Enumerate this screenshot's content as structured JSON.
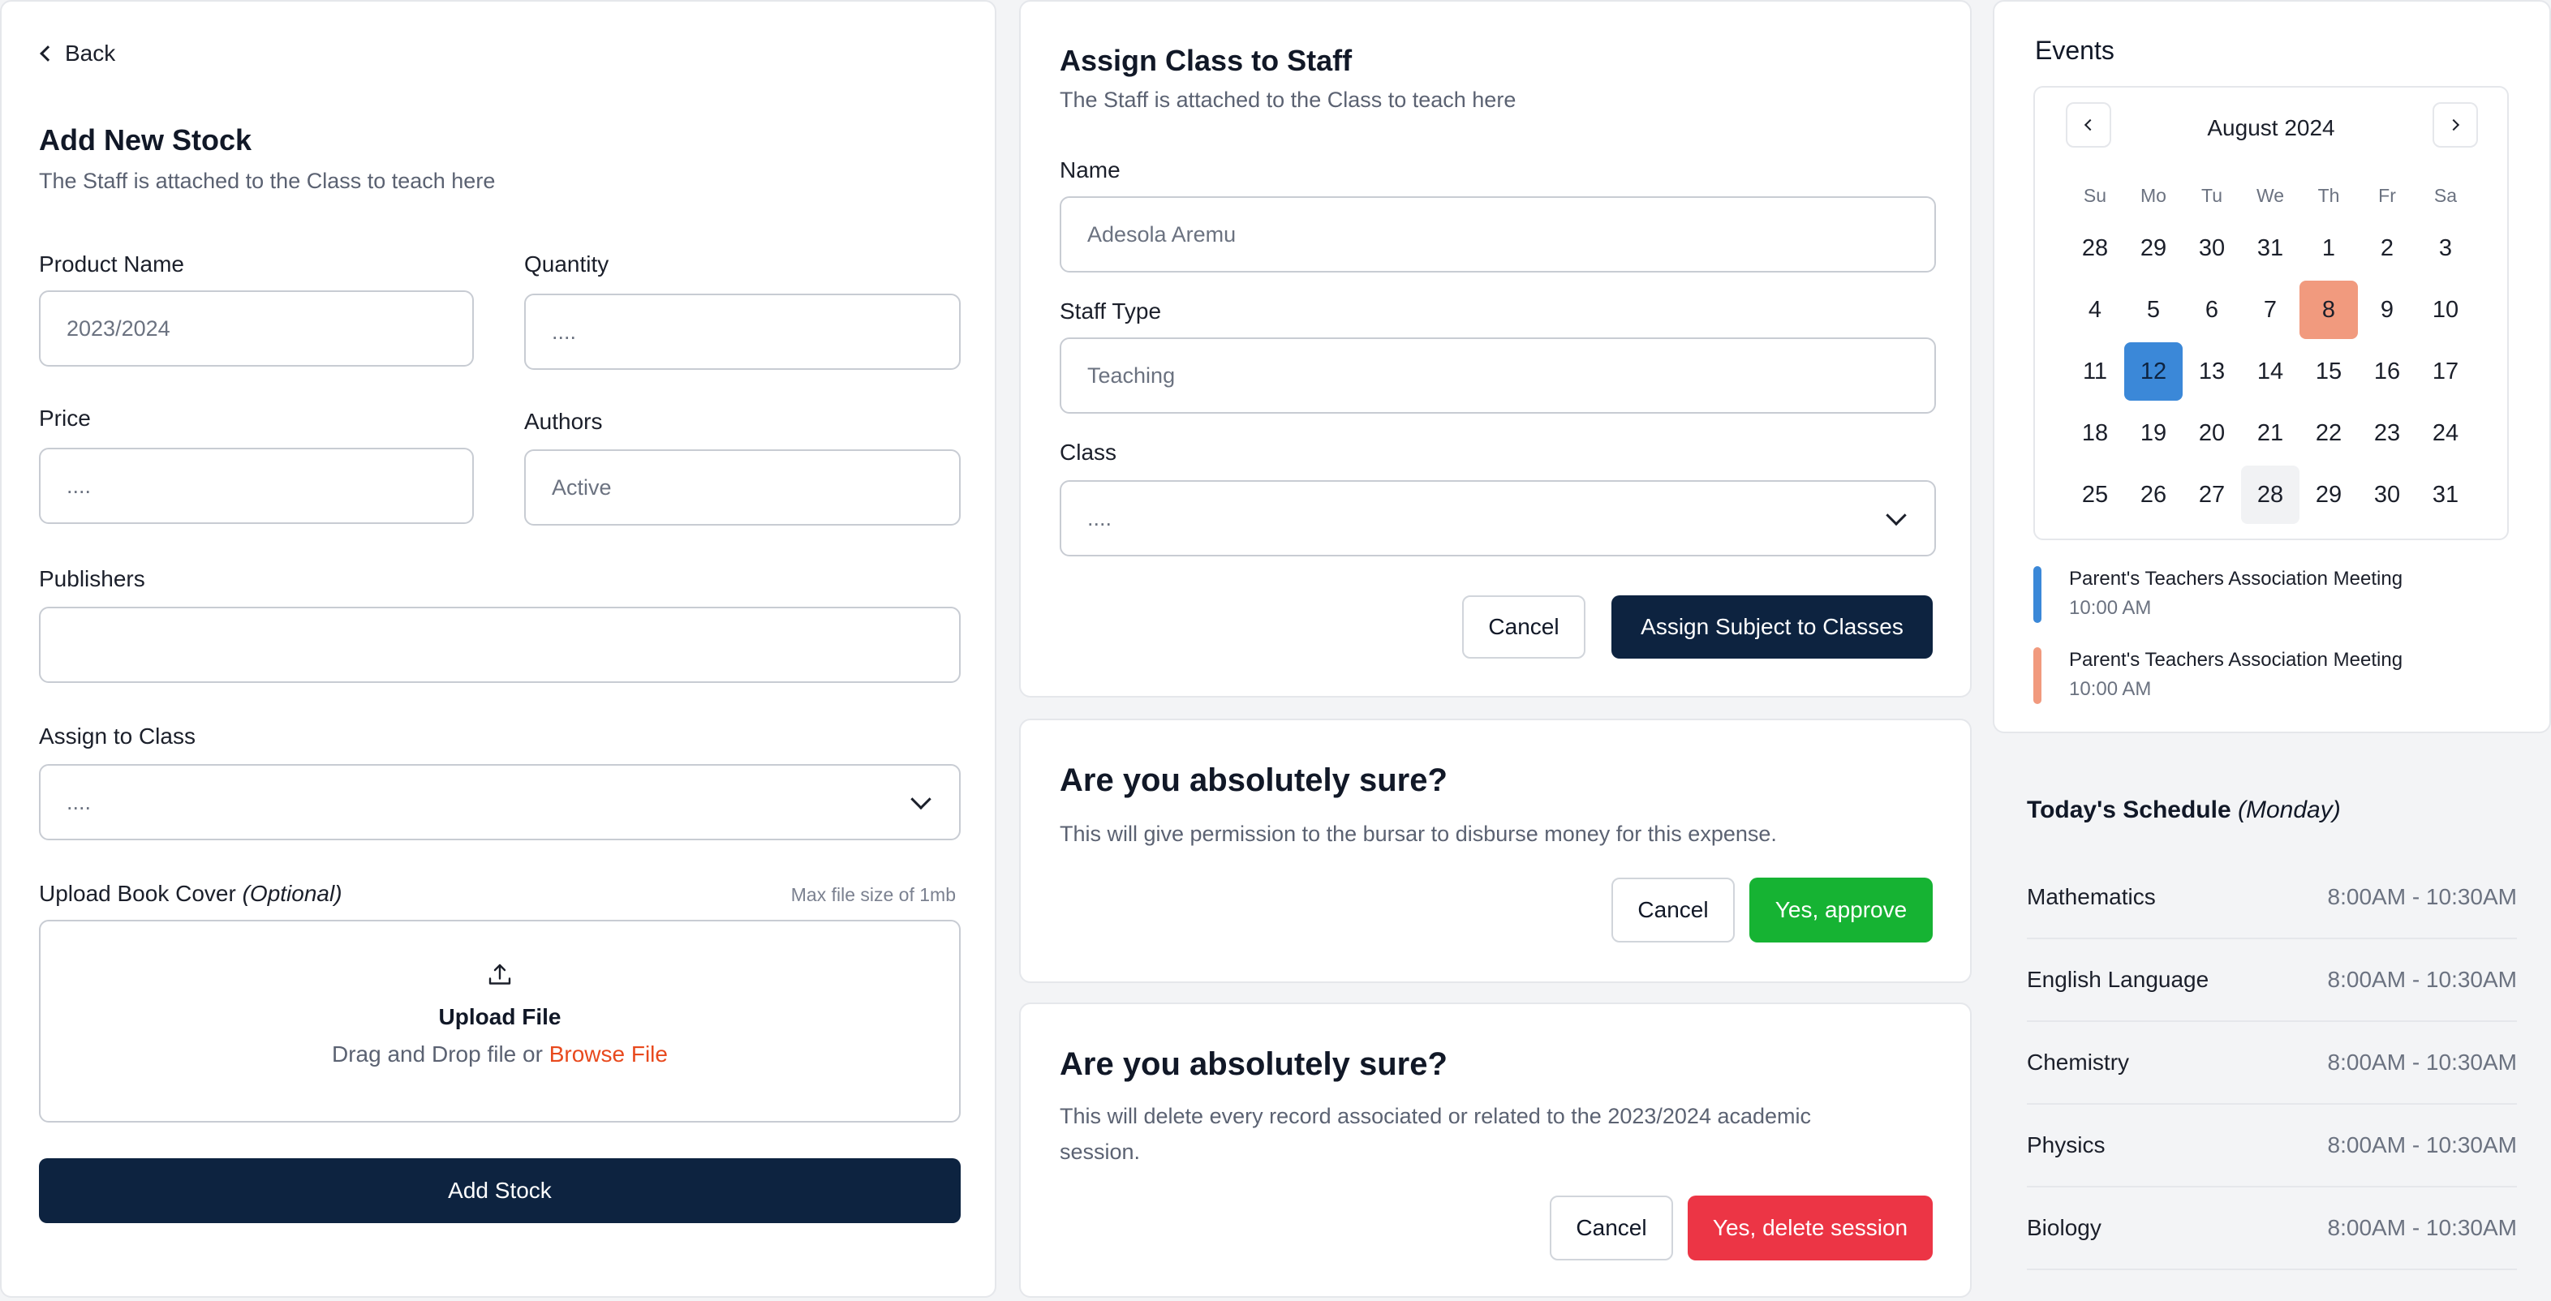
{
  "stock_form": {
    "back_label": "Back",
    "title": "Add New Stock",
    "subtitle": "The Staff is attached to the Class to teach here",
    "product_name_label": "Product Name",
    "product_name_value": "2023/2024",
    "quantity_label": "Quantity",
    "quantity_value": "....",
    "price_label": "Price",
    "price_value": "....",
    "authors_label": "Authors",
    "authors_value": "Active",
    "publishers_label": "Publishers",
    "publishers_value": "",
    "assign_class_label": "Assign to Class",
    "assign_class_value": "....",
    "upload_label": "Upload Book Cover",
    "upload_optional": "(Optional)",
    "upload_max": "Max file size of 1mb",
    "upload_title": "Upload File",
    "upload_hint": "Drag and Drop file or",
    "upload_browse": "Browse File",
    "submit_label": "Add Stock"
  },
  "assign_form": {
    "title": "Assign Class to Staff",
    "subtitle": "The Staff is attached to the Class to teach here",
    "name_label": "Name",
    "name_value": "Adesola Aremu",
    "staff_type_label": "Staff Type",
    "staff_type_value": "Teaching",
    "class_label": "Class",
    "class_value": "....",
    "cancel_label": "Cancel",
    "submit_label": "Assign Subject to Classes"
  },
  "confirm_approve": {
    "title": "Are you absolutely sure?",
    "text": "This will give permission to the bursar to disburse money for this expense.",
    "cancel_label": "Cancel",
    "confirm_label": "Yes, approve"
  },
  "confirm_delete": {
    "title": "Are you absolutely sure?",
    "text_line1": "This will delete every record associated or related to the 2023/2024 academic",
    "text_line2": "session.",
    "cancel_label": "Cancel",
    "confirm_label": "Yes, delete session"
  },
  "events": {
    "title": "Events",
    "month": "August 2024",
    "weekdays": [
      "Su",
      "Mo",
      "Tu",
      "We",
      "Th",
      "Fr",
      "Sa"
    ],
    "weeks": [
      [
        "28",
        "29",
        "30",
        "31",
        "1",
        "2",
        "3"
      ],
      [
        "4",
        "5",
        "6",
        "7",
        "8",
        "9",
        "10"
      ],
      [
        "11",
        "12",
        "13",
        "14",
        "15",
        "16",
        "17"
      ],
      [
        "18",
        "19",
        "20",
        "21",
        "22",
        "23",
        "24"
      ],
      [
        "25",
        "26",
        "27",
        "28",
        "29",
        "30",
        "31"
      ]
    ],
    "selected_day": "12",
    "event_day": "8",
    "hover_day": "28",
    "items": [
      {
        "title": "Parent's Teachers Association Meeting",
        "time": "10:00 AM",
        "color": "#3b88d8"
      },
      {
        "title": "Parent's Teachers Association Meeting",
        "time": "10:00 AM",
        "color": "#f19a7e"
      }
    ]
  },
  "schedule": {
    "title": "Today's Schedule",
    "day": "(Monday)",
    "rows": [
      {
        "subject": "Mathematics",
        "time": "8:00AM - 10:30AM"
      },
      {
        "subject": "English Language",
        "time": "8:00AM - 10:30AM"
      },
      {
        "subject": "Chemistry",
        "time": "8:00AM - 10:30AM"
      },
      {
        "subject": "Physics",
        "time": "8:00AM - 10:30AM"
      },
      {
        "subject": "Biology",
        "time": "8:00AM - 10:30AM"
      }
    ]
  },
  "colors": {
    "navy": "#0d2340",
    "green": "#16b333",
    "red": "#ec3545",
    "accent_orange": "#e8491d",
    "selected_blue": "#3b88d8",
    "event_salmon": "#f19a7e"
  }
}
